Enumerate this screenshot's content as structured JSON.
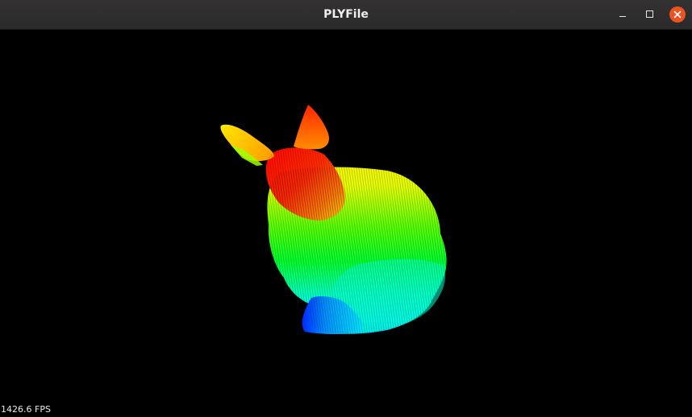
{
  "window": {
    "title": "PLYFile",
    "buttons": {
      "minimize_icon": "minimize-icon",
      "maximize_icon": "maximize-icon",
      "close_icon": "close-icon"
    },
    "close_color": "#e95420"
  },
  "viewport": {
    "background": "#000000",
    "fps_text": "1426.6 FPS",
    "model_colormap": [
      "#0000ff",
      "#00ffff",
      "#00ff00",
      "#ffff00",
      "#ff0000"
    ]
  }
}
